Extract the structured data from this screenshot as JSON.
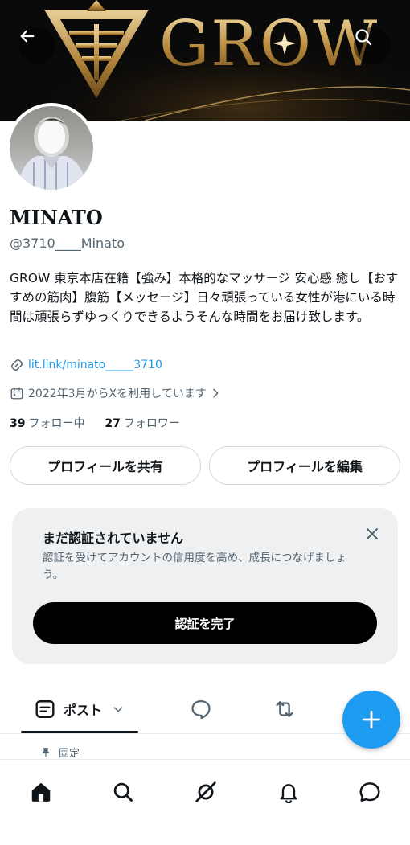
{
  "banner": {
    "brand_text": "GROW"
  },
  "profile": {
    "name": "MINATO",
    "handle": "@3710____Minato",
    "bio": "GROW 東京本店在籍【強み】本格的なマッサージ 安心感 癒し【おすすめの筋肉】腹筋【メッセージ】日々頑張っている女性が港にいる時間は頑張らずゆっくりできるようそんな時間をお届け致します。",
    "link": "lit.link/minato_____3710",
    "joined": "2022年3月からXを利用しています",
    "following_count": "39",
    "following_label": "フォロー中",
    "followers_count": "27",
    "followers_label": "フォロワー"
  },
  "actions": {
    "share_label": "プロフィールを共有",
    "edit_label": "プロフィールを編集"
  },
  "verification": {
    "title": "まだ認証されていません",
    "description": "認証を受けてアカウントの信用度を高め、成長につなげましょう。",
    "button_label": "認証を完了"
  },
  "tabs": {
    "posts_label": "ポスト"
  },
  "pinned_label": "固定",
  "colors": {
    "accent": "#1d9bf0",
    "text": "#0f1419",
    "muted": "#536471",
    "card": "#eff0f1"
  },
  "icons": {
    "header": [
      "back-arrow-icon",
      "search-icon"
    ],
    "tabs": [
      "posts-icon",
      "chevron-down-icon",
      "reply-icon",
      "repost-icon"
    ],
    "fab": "plus-icon",
    "nav": [
      "home-icon",
      "search-icon",
      "grok-icon",
      "bell-icon",
      "messages-icon"
    ]
  }
}
